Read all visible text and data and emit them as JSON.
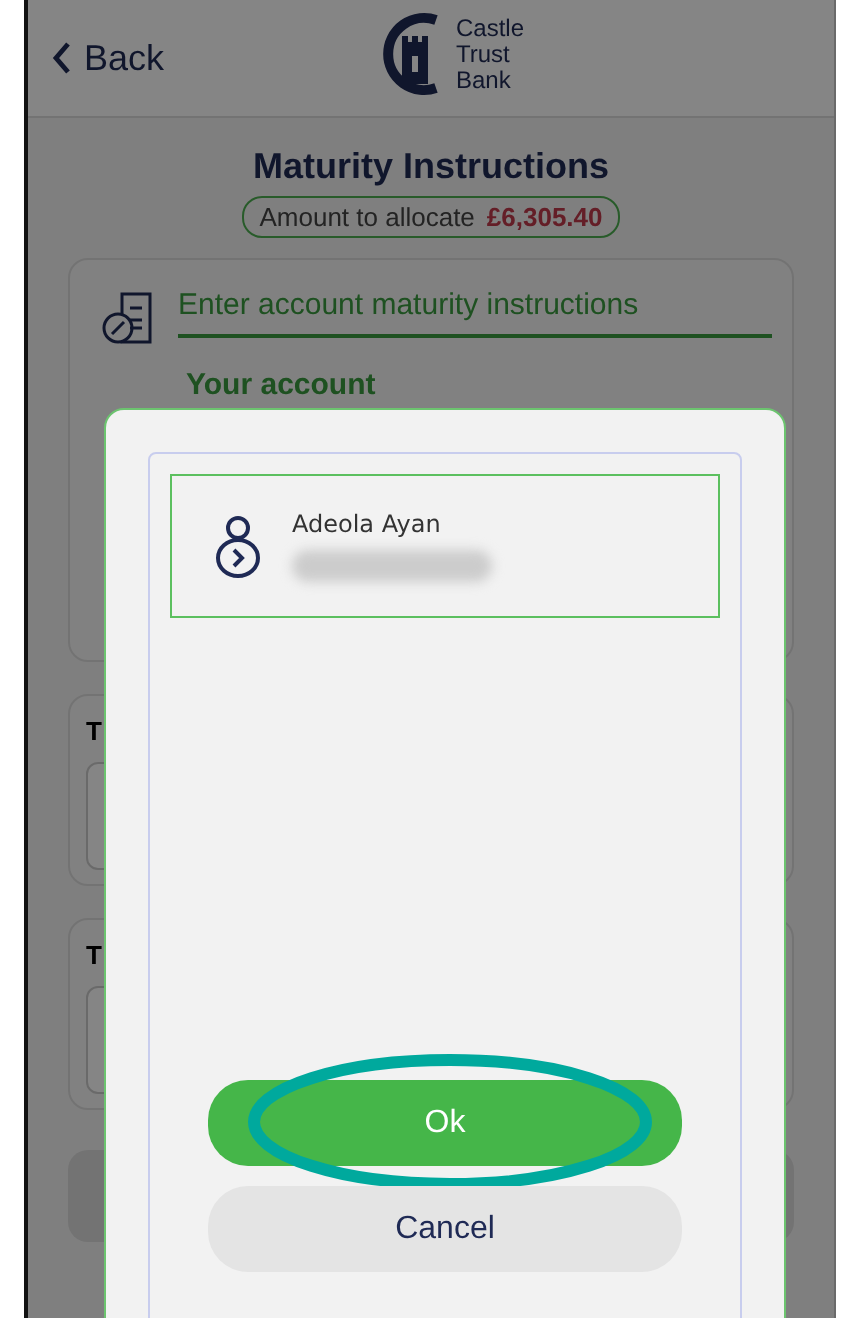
{
  "header": {
    "back": "Back",
    "logo": [
      "Castle",
      "Trust",
      "Bank"
    ]
  },
  "title": "Maturity Instructions",
  "amount": {
    "label": "Amount to allocate",
    "value": "£6,305.40"
  },
  "instructions_card": {
    "heading": "Enter account maturity instructions",
    "subheading": "Your account"
  },
  "transfer_cards": [
    {
      "label": "T"
    },
    {
      "label": "T"
    }
  ],
  "dialog": {
    "accounts": [
      {
        "name": "Adeola Ayan",
        "selected": true
      }
    ],
    "buttons": [
      {
        "label": "Ok",
        "kind": "primary",
        "highlighted": true
      },
      {
        "label": "Cancel",
        "kind": "secondary",
        "highlighted": false
      }
    ]
  }
}
